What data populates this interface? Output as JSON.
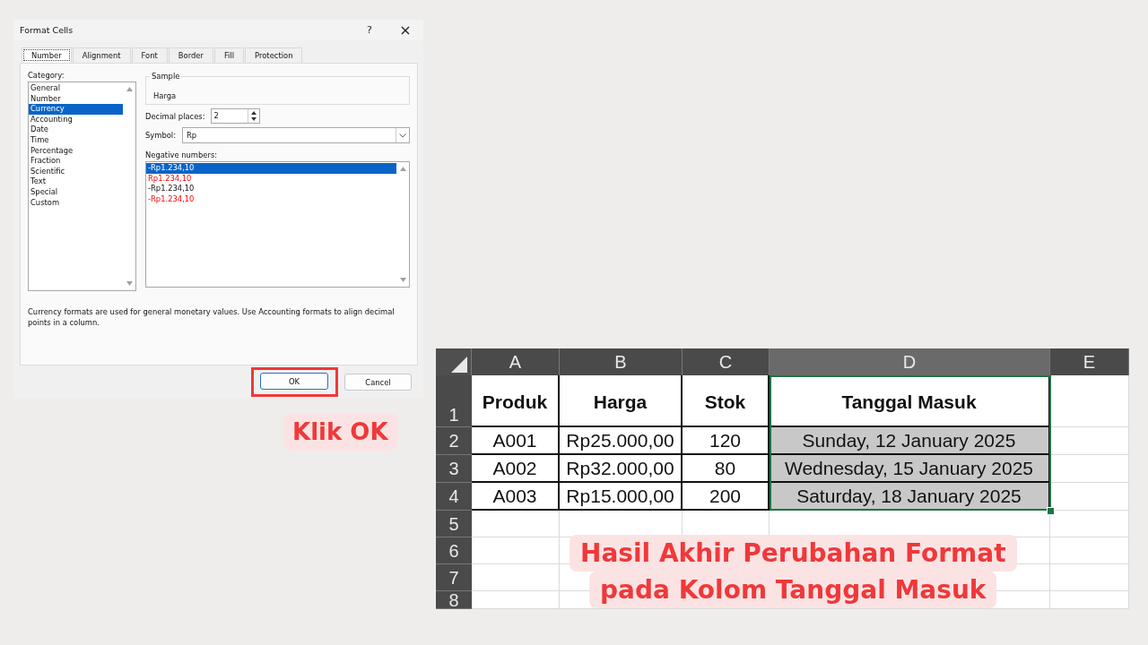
{
  "dialog": {
    "title": "Format Cells",
    "help": "?",
    "close": "×",
    "tabs": [
      {
        "label": "Number",
        "selected": true
      },
      {
        "label": "Alignment",
        "selected": false
      },
      {
        "label": "Font",
        "selected": false
      },
      {
        "label": "Border",
        "selected": false
      },
      {
        "label": "Fill",
        "selected": false
      },
      {
        "label": "Protection",
        "selected": false
      }
    ],
    "category_label": "Category:",
    "categories": [
      {
        "label": "General",
        "selected": false
      },
      {
        "label": "Number",
        "selected": false
      },
      {
        "label": "Currency",
        "selected": true
      },
      {
        "label": "Accounting",
        "selected": false
      },
      {
        "label": "Date",
        "selected": false
      },
      {
        "label": "Time",
        "selected": false
      },
      {
        "label": "Percentage",
        "selected": false
      },
      {
        "label": "Fraction",
        "selected": false
      },
      {
        "label": "Scientific",
        "selected": false
      },
      {
        "label": "Text",
        "selected": false
      },
      {
        "label": "Special",
        "selected": false
      },
      {
        "label": "Custom",
        "selected": false
      }
    ],
    "sample_label": "Sample",
    "sample_value": "Harga",
    "decimal_label": "Decimal places:",
    "decimal_value": "2",
    "symbol_label": "Symbol:",
    "symbol_value": "Rp",
    "negative_label": "Negative numbers:",
    "negative_formats": [
      {
        "label": "-Rp1.234,10",
        "red": false,
        "selected": true
      },
      {
        "label": "Rp1.234,10",
        "red": true,
        "selected": false
      },
      {
        "label": "-Rp1.234,10",
        "red": false,
        "selected": false
      },
      {
        "label": "-Rp1.234,10",
        "red": true,
        "selected": false
      }
    ],
    "description": "Currency formats are used for general monetary values.  Use Accounting formats to align decimal points in a column.",
    "buttons": [
      {
        "label": "OK",
        "highlighted": true
      },
      {
        "label": "Cancel",
        "highlighted": false
      }
    ]
  },
  "caption_ok": "Klik OK",
  "sheet": {
    "columns": [
      {
        "label": "A",
        "selected": false
      },
      {
        "label": "B",
        "selected": false
      },
      {
        "label": "C",
        "selected": false
      },
      {
        "label": "D",
        "selected": true
      },
      {
        "label": "E",
        "selected": false
      }
    ],
    "rows": [
      {
        "number": "1",
        "kind": "header",
        "cells": [
          "Produk",
          "Harga",
          "Stok",
          "Tanggal Masuk"
        ]
      },
      {
        "number": "2",
        "kind": "data",
        "cells": [
          "A001",
          "Rp25.000,00",
          "120",
          "Sunday, 12 January 2025"
        ]
      },
      {
        "number": "3",
        "kind": "data",
        "cells": [
          "A002",
          "Rp32.000,00",
          "80",
          "Wednesday, 15 January 2025"
        ]
      },
      {
        "number": "4",
        "kind": "data",
        "cells": [
          "A003",
          "Rp15.000,00",
          "200",
          "Saturday, 18 January 2025"
        ]
      },
      {
        "number": "5",
        "kind": "empty",
        "cells": []
      },
      {
        "number": "6",
        "kind": "empty",
        "cells": []
      },
      {
        "number": "7",
        "kind": "empty",
        "cells": []
      },
      {
        "number": "8",
        "kind": "empty",
        "cells": []
      }
    ]
  },
  "caption_result": [
    "Hasil Akhir Perubahan Format",
    "pada Kolom Tanggal Masuk"
  ]
}
